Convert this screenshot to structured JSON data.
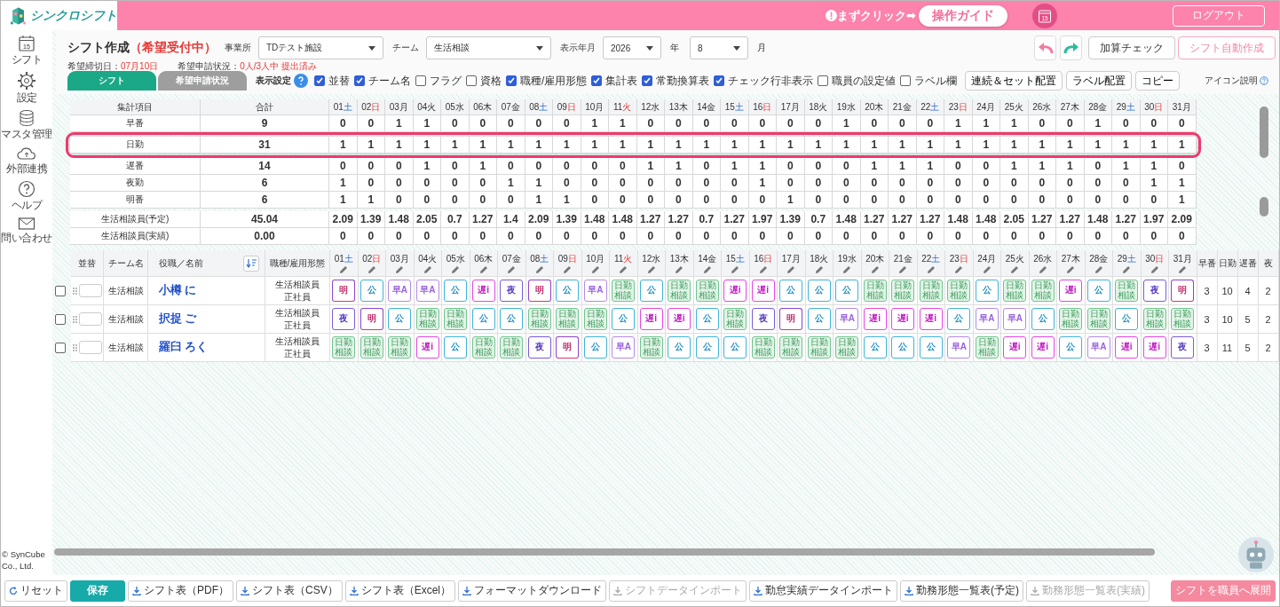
{
  "header": {
    "logo": "シンクロシフト",
    "guide_hint": "まずクリック➡",
    "guide_button": "操作ガイド",
    "calendar_day": "15",
    "logout": "ログアウト"
  },
  "sidebar": {
    "items": [
      {
        "label": "シフト",
        "kind": "calendar",
        "badge": "15"
      },
      {
        "label": "設定",
        "kind": "gear"
      },
      {
        "label": "マスタ管理",
        "kind": "database"
      },
      {
        "label": "外部連携",
        "kind": "cloud"
      },
      {
        "label": "ヘルプ",
        "kind": "help"
      },
      {
        "label": "問い合わせ",
        "kind": "mail"
      }
    ],
    "copyright": "© SynCube Co., Ltd."
  },
  "page": {
    "title": "シフト作成",
    "status": "（希望受付中）",
    "filters": [
      {
        "label": "事業所",
        "value": "TDテスト施設"
      },
      {
        "label": "チーム",
        "value": "生活相談"
      },
      {
        "label": "表示年月",
        "value": "2026",
        "suffix": "年"
      },
      {
        "value": "8",
        "suffix": "月"
      }
    ],
    "deadline_label": "希望締切日：",
    "deadline": "07月10日",
    "request_label": "希望申請状況：",
    "request_status": "0人/3人中 提出済み",
    "actions": [
      {
        "label": "加算チェック",
        "kind": "plain"
      },
      {
        "label": "シフト自動作成",
        "kind": "accent"
      }
    ]
  },
  "tabs": [
    {
      "label": "シフト",
      "selected": true
    },
    {
      "label": "希望申請状況",
      "selected": false
    }
  ],
  "display_settings": {
    "label": "表示設定",
    "options": [
      {
        "label": "並替",
        "checked": true
      },
      {
        "label": "チーム名",
        "checked": true
      },
      {
        "label": "フラグ",
        "checked": false
      },
      {
        "label": "資格",
        "checked": false
      },
      {
        "label": "職種/雇用形態",
        "checked": true
      },
      {
        "label": "集計表",
        "checked": true
      },
      {
        "label": "常勤換算表",
        "checked": true
      },
      {
        "label": "チェック行非表示",
        "checked": true
      },
      {
        "label": "職員の設定値",
        "checked": false
      },
      {
        "label": "ラベル欄",
        "checked": false
      }
    ]
  },
  "tool_buttons": [
    "連続＆セット配置",
    "ラベル配置",
    "コピー"
  ],
  "icon_help": "アイコン説明",
  "summary": {
    "columns": [
      "集計項目",
      "合計"
    ],
    "days": [
      {
        "date": "01",
        "weekday": "土",
        "kind": "saturday"
      },
      {
        "date": "02",
        "weekday": "日",
        "kind": "sunday"
      },
      {
        "date": "03",
        "weekday": "月",
        "kind": "weekday"
      },
      {
        "date": "04",
        "weekday": "火",
        "kind": "weekday"
      },
      {
        "date": "05",
        "weekday": "水",
        "kind": "weekday"
      },
      {
        "date": "06",
        "weekday": "木",
        "kind": "weekday"
      },
      {
        "date": "07",
        "weekday": "金",
        "kind": "weekday"
      },
      {
        "date": "08",
        "weekday": "土",
        "kind": "saturday"
      },
      {
        "date": "09",
        "weekday": "日",
        "kind": "sunday"
      },
      {
        "date": "10",
        "weekday": "月",
        "kind": "weekday"
      },
      {
        "date": "11",
        "weekday": "火",
        "kind": "holiday"
      },
      {
        "date": "12",
        "weekday": "水",
        "kind": "weekday"
      },
      {
        "date": "13",
        "weekday": "木",
        "kind": "weekday"
      },
      {
        "date": "14",
        "weekday": "金",
        "kind": "weekday"
      },
      {
        "date": "15",
        "weekday": "土",
        "kind": "saturday"
      },
      {
        "date": "16",
        "weekday": "日",
        "kind": "sunday"
      },
      {
        "date": "17",
        "weekday": "月",
        "kind": "weekday"
      },
      {
        "date": "18",
        "weekday": "火",
        "kind": "weekday"
      },
      {
        "date": "19",
        "weekday": "水",
        "kind": "weekday"
      },
      {
        "date": "20",
        "weekday": "木",
        "kind": "weekday"
      },
      {
        "date": "21",
        "weekday": "金",
        "kind": "weekday"
      },
      {
        "date": "22",
        "weekday": "土",
        "kind": "saturday"
      },
      {
        "date": "23",
        "weekday": "日",
        "kind": "sunday"
      },
      {
        "date": "24",
        "weekday": "月",
        "kind": "weekday"
      },
      {
        "date": "25",
        "weekday": "火",
        "kind": "weekday"
      },
      {
        "date": "26",
        "weekday": "水",
        "kind": "weekday"
      },
      {
        "date": "27",
        "weekday": "木",
        "kind": "weekday"
      },
      {
        "date": "28",
        "weekday": "金",
        "kind": "weekday"
      },
      {
        "date": "29",
        "weekday": "土",
        "kind": "saturday"
      },
      {
        "date": "30",
        "weekday": "日",
        "kind": "sunday"
      },
      {
        "date": "31",
        "weekday": "月",
        "kind": "weekday"
      }
    ],
    "shift_rows": [
      {
        "label": "早番",
        "total": "9",
        "highlighted": false,
        "values": [
          "0",
          "0",
          "1",
          "1",
          "0",
          "0",
          "0",
          "0",
          "0",
          "1",
          "1",
          "0",
          "0",
          "0",
          "0",
          "0",
          "0",
          "0",
          "1",
          "0",
          "0",
          "0",
          "1",
          "1",
          "1",
          "0",
          "0",
          "1",
          "0",
          "0",
          "0"
        ]
      },
      {
        "label": "日勤",
        "total": "31",
        "highlighted": true,
        "values": [
          "1",
          "1",
          "1",
          "1",
          "1",
          "1",
          "1",
          "1",
          "1",
          "1",
          "1",
          "1",
          "1",
          "1",
          "1",
          "1",
          "1",
          "1",
          "1",
          "1",
          "1",
          "1",
          "1",
          "1",
          "1",
          "1",
          "1",
          "1",
          "1",
          "1",
          "1"
        ]
      },
      {
        "label": "遅番",
        "total": "14",
        "highlighted": false,
        "values": [
          "0",
          "0",
          "0",
          "1",
          "0",
          "1",
          "0",
          "0",
          "0",
          "0",
          "0",
          "1",
          "1",
          "0",
          "1",
          "1",
          "0",
          "0",
          "0",
          "1",
          "1",
          "1",
          "0",
          "0",
          "1",
          "1",
          "1",
          "0",
          "1",
          "1",
          "0"
        ]
      },
      {
        "label": "夜勤",
        "total": "6",
        "highlighted": false,
        "values": [
          "1",
          "0",
          "0",
          "0",
          "0",
          "0",
          "1",
          "1",
          "0",
          "0",
          "0",
          "0",
          "0",
          "0",
          "0",
          "1",
          "0",
          "0",
          "0",
          "0",
          "0",
          "0",
          "0",
          "0",
          "0",
          "0",
          "0",
          "0",
          "0",
          "1",
          "1"
        ]
      },
      {
        "label": "明番",
        "total": "6",
        "highlighted": false,
        "values": [
          "1",
          "1",
          "0",
          "0",
          "0",
          "0",
          "0",
          "1",
          "1",
          "0",
          "0",
          "0",
          "0",
          "0",
          "0",
          "0",
          "1",
          "0",
          "0",
          "0",
          "0",
          "0",
          "0",
          "0",
          "0",
          "0",
          "0",
          "0",
          "0",
          "0",
          "1"
        ]
      }
    ],
    "staffing_rows": [
      {
        "label": "生活相談員(予定)",
        "total": "45.04",
        "values": [
          "2.09",
          "1.39",
          "1.48",
          "2.05",
          "0.7",
          "1.27",
          "1.4",
          "2.09",
          "1.39",
          "1.48",
          "1.48",
          "1.27",
          "1.27",
          "0.7",
          "1.27",
          "1.97",
          "1.39",
          "0.7",
          "1.48",
          "1.27",
          "1.27",
          "1.27",
          "1.48",
          "1.48",
          "2.05",
          "1.27",
          "1.27",
          "1.48",
          "1.27",
          "1.97",
          "2.09"
        ]
      },
      {
        "label": "生活相談員(実績)",
        "total": "0.00",
        "values": [
          "0",
          "0",
          "0",
          "0",
          "0",
          "0",
          "0",
          "0",
          "0",
          "0",
          "0",
          "0",
          "0",
          "0",
          "0",
          "0",
          "0",
          "0",
          "0",
          "0",
          "0",
          "0",
          "0",
          "0",
          "0",
          "0",
          "0",
          "0",
          "0",
          "0",
          "0"
        ]
      }
    ]
  },
  "staff_table": {
    "columns": [
      "並替",
      "チーム名",
      "役職／名前",
      "職種/雇用形態"
    ],
    "days": [
      {
        "date": "01",
        "weekday": "土",
        "kind": "saturday"
      },
      {
        "date": "02",
        "weekday": "日",
        "kind": "sunday"
      },
      {
        "date": "03",
        "weekday": "月",
        "kind": "weekday"
      },
      {
        "date": "04",
        "weekday": "火",
        "kind": "weekday"
      },
      {
        "date": "05",
        "weekday": "水",
        "kind": "weekday"
      },
      {
        "date": "06",
        "weekday": "木",
        "kind": "weekday"
      },
      {
        "date": "07",
        "weekday": "金",
        "kind": "weekday"
      },
      {
        "date": "08",
        "weekday": "土",
        "kind": "saturday"
      },
      {
        "date": "09",
        "weekday": "日",
        "kind": "sunday"
      },
      {
        "date": "10",
        "weekday": "月",
        "kind": "weekday"
      },
      {
        "date": "11",
        "weekday": "火",
        "kind": "holiday"
      },
      {
        "date": "12",
        "weekday": "水",
        "kind": "weekday"
      },
      {
        "date": "13",
        "weekday": "木",
        "kind": "weekday"
      },
      {
        "date": "14",
        "weekday": "金",
        "kind": "weekday"
      },
      {
        "date": "15",
        "weekday": "土",
        "kind": "saturday"
      },
      {
        "date": "16",
        "weekday": "日",
        "kind": "sunday"
      },
      {
        "date": "17",
        "weekday": "月",
        "kind": "weekday"
      },
      {
        "date": "18",
        "weekday": "火",
        "kind": "weekday"
      },
      {
        "date": "19",
        "weekday": "水",
        "kind": "weekday"
      },
      {
        "date": "20",
        "weekday": "木",
        "kind": "weekday"
      },
      {
        "date": "21",
        "weekday": "金",
        "kind": "weekday"
      },
      {
        "date": "22",
        "weekday": "土",
        "kind": "saturday"
      },
      {
        "date": "23",
        "weekday": "日",
        "kind": "sunday"
      },
      {
        "date": "24",
        "weekday": "月",
        "kind": "weekday"
      },
      {
        "date": "25",
        "weekday": "火",
        "kind": "weekday"
      },
      {
        "date": "26",
        "weekday": "水",
        "kind": "weekday"
      },
      {
        "date": "27",
        "weekday": "木",
        "kind": "weekday"
      },
      {
        "date": "28",
        "weekday": "金",
        "kind": "weekday"
      },
      {
        "date": "29",
        "weekday": "土",
        "kind": "saturday"
      },
      {
        "date": "30",
        "weekday": "日",
        "kind": "sunday"
      },
      {
        "date": "31",
        "weekday": "月",
        "kind": "weekday"
      }
    ],
    "count_columns": [
      "早番",
      "日勤",
      "遅番",
      "夜"
    ],
    "rows": [
      {
        "checked": false,
        "team": "生活相談",
        "name": "小樽 に",
        "role": "生活相談員",
        "employment": "正社員",
        "counts": [
          "3",
          "10",
          "4",
          "2"
        ],
        "shifts": [
          {
            "label": "明",
            "kind": "after"
          },
          {
            "label": "公",
            "kind": "off"
          },
          {
            "label": "早A",
            "kind": "early"
          },
          {
            "label": "早A",
            "kind": "early"
          },
          {
            "label": "公",
            "kind": "off"
          },
          {
            "label": "遅i",
            "kind": "late"
          },
          {
            "label": "夜",
            "kind": "night"
          },
          {
            "label": "明",
            "kind": "after"
          },
          {
            "label": "公",
            "kind": "off"
          },
          {
            "label": "早A",
            "kind": "early"
          },
          {
            "label": "日勤相談",
            "kind": "day"
          },
          {
            "label": "公",
            "kind": "off"
          },
          {
            "label": "日勤相談",
            "kind": "day"
          },
          {
            "label": "日勤相談",
            "kind": "day"
          },
          {
            "label": "遅i",
            "kind": "late"
          },
          {
            "label": "遅i",
            "kind": "late"
          },
          {
            "label": "公",
            "kind": "off"
          },
          {
            "label": "公",
            "kind": "off"
          },
          {
            "label": "公",
            "kind": "off"
          },
          {
            "label": "日勤相談",
            "kind": "day"
          },
          {
            "label": "日勤相談",
            "kind": "day"
          },
          {
            "label": "日勤相談",
            "kind": "day"
          },
          {
            "label": "日勤相談",
            "kind": "day"
          },
          {
            "label": "公",
            "kind": "off"
          },
          {
            "label": "日勤相談",
            "kind": "day"
          },
          {
            "label": "日勤相談",
            "kind": "day"
          },
          {
            "label": "遅i",
            "kind": "late"
          },
          {
            "label": "公",
            "kind": "off"
          },
          {
            "label": "日勤相談",
            "kind": "day"
          },
          {
            "label": "夜",
            "kind": "night"
          },
          {
            "label": "明",
            "kind": "after"
          }
        ]
      },
      {
        "checked": false,
        "team": "生活相談",
        "name": "択捉 ご",
        "role": "生活相談員",
        "employment": "正社員",
        "counts": [
          "3",
          "10",
          "5",
          "2"
        ],
        "shifts": [
          {
            "label": "夜",
            "kind": "night"
          },
          {
            "label": "明",
            "kind": "after"
          },
          {
            "label": "公",
            "kind": "off"
          },
          {
            "label": "日勤相談",
            "kind": "day"
          },
          {
            "label": "日勤相談",
            "kind": "day"
          },
          {
            "label": "公",
            "kind": "off"
          },
          {
            "label": "公",
            "kind": "off"
          },
          {
            "label": "日勤相談",
            "kind": "day"
          },
          {
            "label": "日勤相談",
            "kind": "day"
          },
          {
            "label": "日勤相談",
            "kind": "day"
          },
          {
            "label": "公",
            "kind": "off"
          },
          {
            "label": "遅i",
            "kind": "late"
          },
          {
            "label": "遅i",
            "kind": "late"
          },
          {
            "label": "公",
            "kind": "off"
          },
          {
            "label": "日勤相談",
            "kind": "day"
          },
          {
            "label": "夜",
            "kind": "night"
          },
          {
            "label": "明",
            "kind": "after"
          },
          {
            "label": "公",
            "kind": "off"
          },
          {
            "label": "早A",
            "kind": "early"
          },
          {
            "label": "遅i",
            "kind": "late"
          },
          {
            "label": "遅i",
            "kind": "late"
          },
          {
            "label": "遅i",
            "kind": "late"
          },
          {
            "label": "公",
            "kind": "off"
          },
          {
            "label": "早A",
            "kind": "early"
          },
          {
            "label": "早A",
            "kind": "early"
          },
          {
            "label": "公",
            "kind": "off"
          },
          {
            "label": "日勤相談",
            "kind": "day"
          },
          {
            "label": "日勤相談",
            "kind": "day"
          },
          {
            "label": "公",
            "kind": "off"
          },
          {
            "label": "日勤相談",
            "kind": "day"
          },
          {
            "label": "日勤相談",
            "kind": "day"
          }
        ]
      },
      {
        "checked": false,
        "team": "生活相談",
        "name": "羅臼 ろく",
        "role": "生活相談員",
        "employment": "正社員",
        "counts": [
          "3",
          "11",
          "5",
          "2"
        ],
        "shifts": [
          {
            "label": "日勤相談",
            "kind": "day"
          },
          {
            "label": "日勤相談",
            "kind": "day"
          },
          {
            "label": "日勤相談",
            "kind": "day"
          },
          {
            "label": "遅i",
            "kind": "late"
          },
          {
            "label": "公",
            "kind": "off"
          },
          {
            "label": "日勤相談",
            "kind": "day"
          },
          {
            "label": "日勤相談",
            "kind": "day"
          },
          {
            "label": "夜",
            "kind": "night"
          },
          {
            "label": "明",
            "kind": "after"
          },
          {
            "label": "公",
            "kind": "off"
          },
          {
            "label": "早A",
            "kind": "early"
          },
          {
            "label": "日勤相談",
            "kind": "day"
          },
          {
            "label": "公",
            "kind": "off"
          },
          {
            "label": "公",
            "kind": "off"
          },
          {
            "label": "公",
            "kind": "off"
          },
          {
            "label": "日勤相談",
            "kind": "day"
          },
          {
            "label": "日勤相談",
            "kind": "day"
          },
          {
            "label": "日勤相談",
            "kind": "day"
          },
          {
            "label": "日勤相談",
            "kind": "day"
          },
          {
            "label": "公",
            "kind": "off"
          },
          {
            "label": "公",
            "kind": "off"
          },
          {
            "label": "公",
            "kind": "off"
          },
          {
            "label": "早A",
            "kind": "early"
          },
          {
            "label": "日勤相談",
            "kind": "day"
          },
          {
            "label": "遅i",
            "kind": "late"
          },
          {
            "label": "遅i",
            "kind": "late"
          },
          {
            "label": "公",
            "kind": "off"
          },
          {
            "label": "早A",
            "kind": "early"
          },
          {
            "label": "遅i",
            "kind": "late"
          },
          {
            "label": "遅i",
            "kind": "late"
          },
          {
            "label": "夜",
            "kind": "night"
          }
        ]
      }
    ]
  },
  "footer": {
    "buttons": [
      {
        "label": "リセット",
        "kind": "reset",
        "disabled": false
      },
      {
        "label": "保存",
        "kind": "primary",
        "disabled": false
      },
      {
        "label": "シフト表（PDF）",
        "kind": "download",
        "disabled": false
      },
      {
        "label": "シフト表（CSV）",
        "kind": "download",
        "disabled": false
      },
      {
        "label": "シフト表（Excel）",
        "kind": "download",
        "disabled": false
      },
      {
        "label": "フォーマットダウンロード",
        "kind": "download",
        "disabled": false
      },
      {
        "label": "シフトデータインポート",
        "kind": "download",
        "disabled": true
      },
      {
        "label": "勤怠実績データインポート",
        "kind": "download",
        "disabled": false
      },
      {
        "label": "勤務形態一覧表(予定)",
        "kind": "download",
        "disabled": false
      },
      {
        "label": "勤務形態一覧表(実績)",
        "kind": "download",
        "disabled": true
      },
      {
        "label": "シフトを職員へ展開",
        "kind": "accent",
        "disabled": false
      }
    ]
  }
}
